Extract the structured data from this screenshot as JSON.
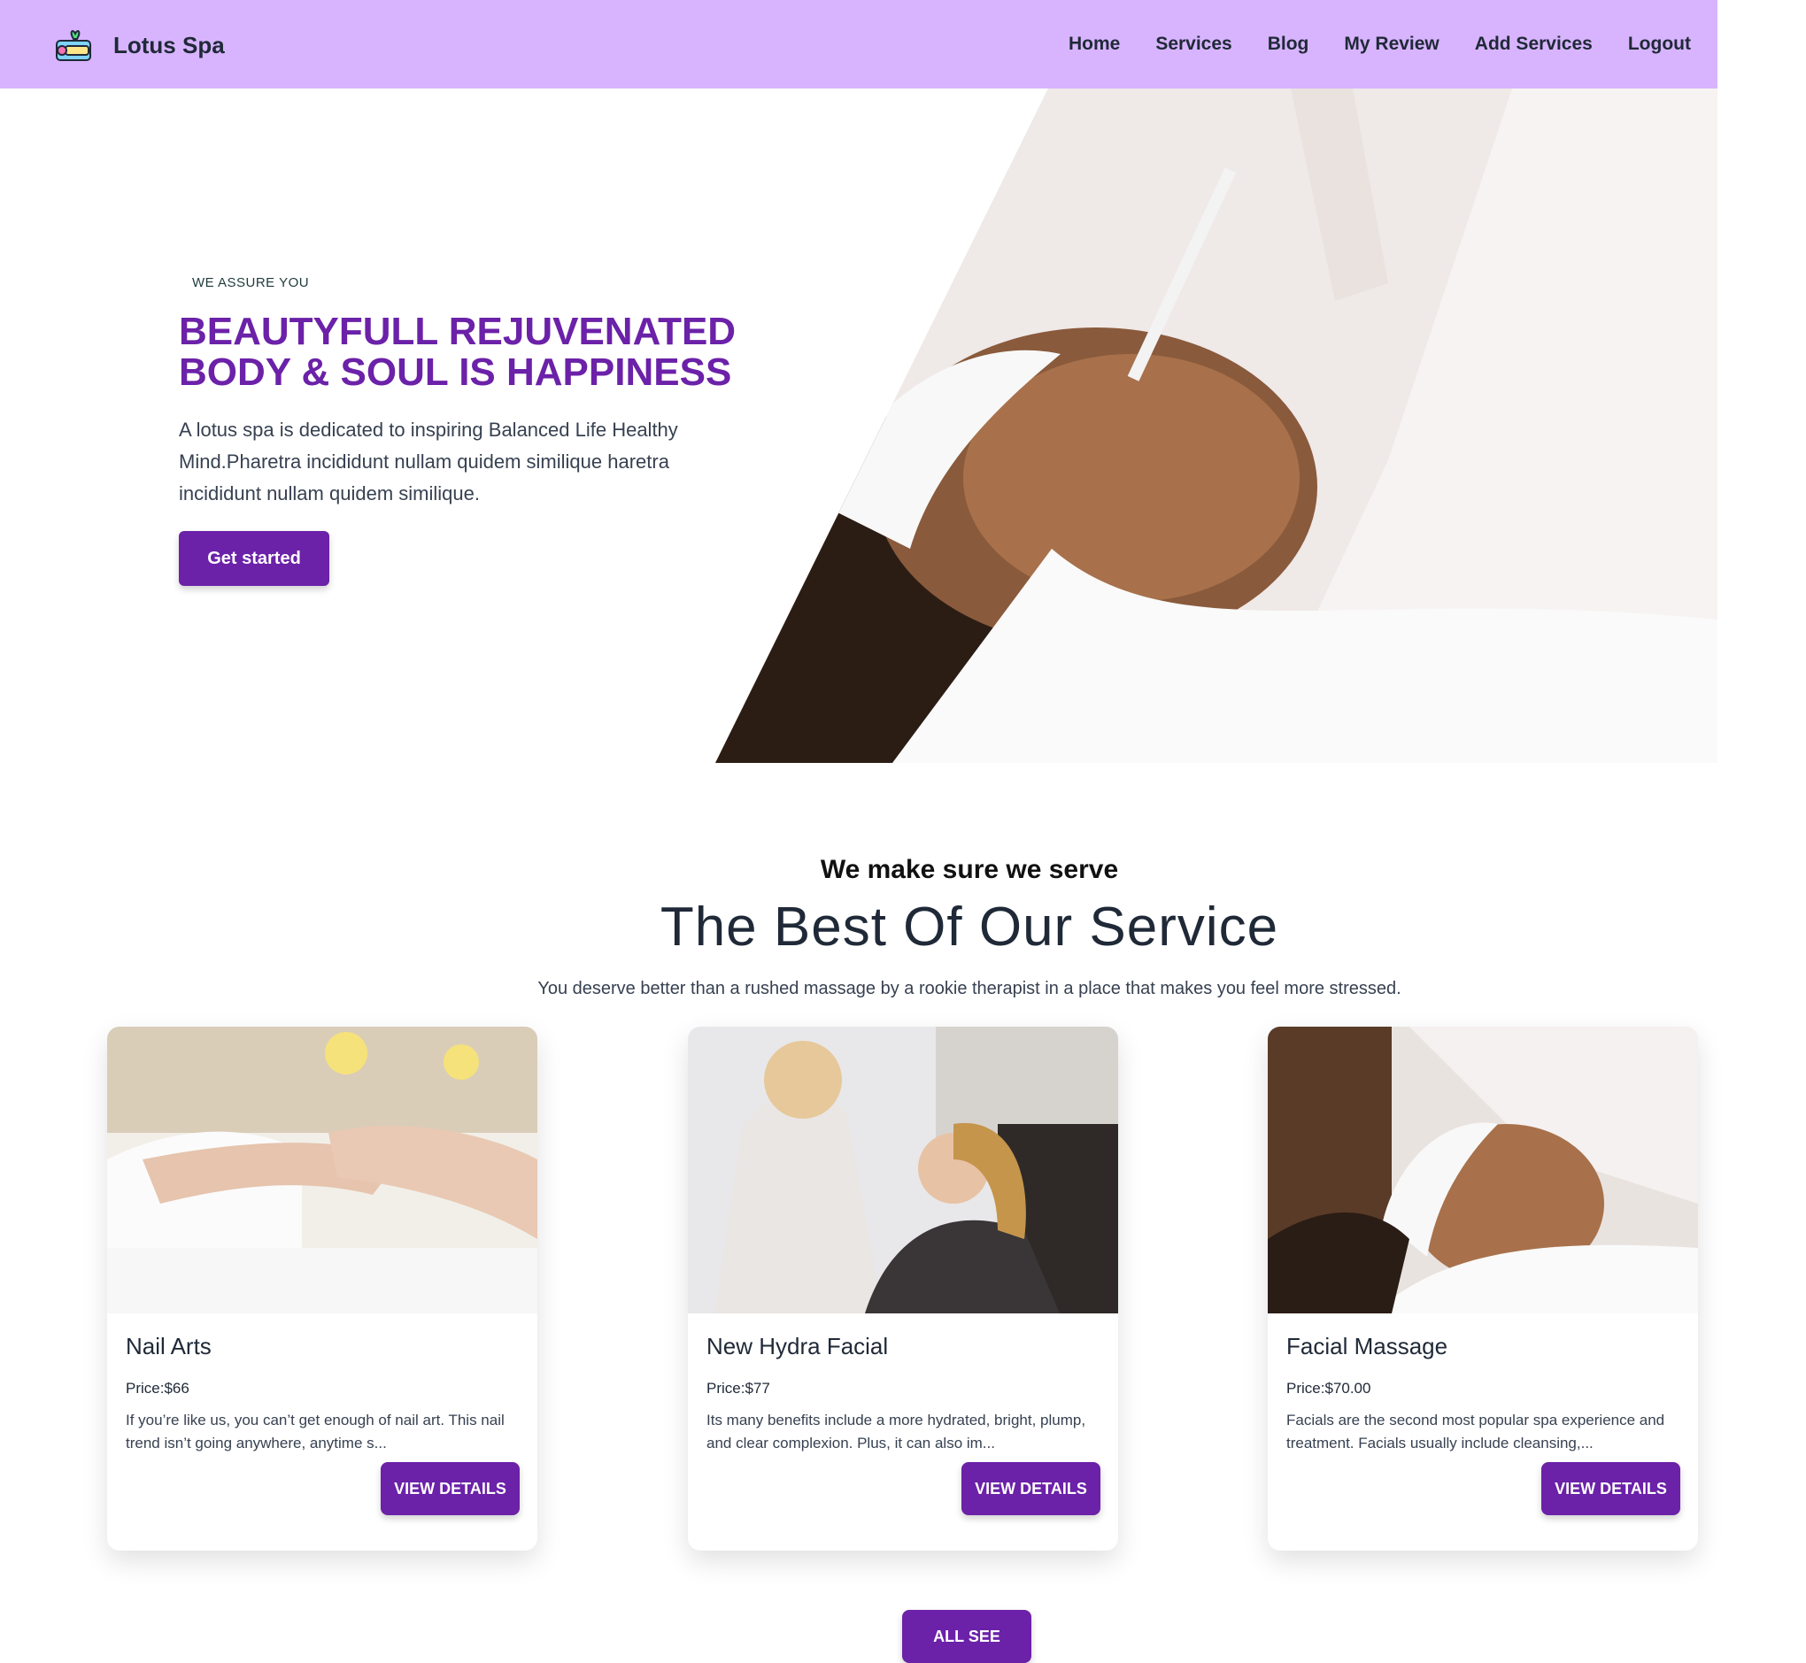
{
  "navbar": {
    "brand": "Lotus Spa",
    "logo_icon": "spa-logo-icon",
    "links": [
      "Home",
      "Services",
      "Blog",
      "My Review",
      "Add Services",
      "Logout"
    ]
  },
  "hero": {
    "eyebrow": "WE ASSURE YOU",
    "title_line1": "BEAUTYFULL REJUVENATED",
    "title_line2": "BODY & SOUL IS HAPPINESS",
    "text": "A lotus spa is dedicated to inspiring Balanced Life Healthy Mind.Pharetra incididunt nullam quidem similique haretra incididunt nullam quidem similique.",
    "button": "Get started"
  },
  "services": {
    "subtitle": "We make sure we serve",
    "title": "The Best Of Our Service",
    "description": "You deserve better than a rushed massage by a rookie therapist in a place that makes you feel more stressed.",
    "cards": [
      {
        "title": "Nail Arts",
        "price": "Price:$66",
        "description": "If you’re like us, you can’t get enough of nail art. This nail trend isn’t going anywhere, anytime s...",
        "button": "VIEW DETAILS"
      },
      {
        "title": "New Hydra Facial",
        "price": "Price:$77",
        "description": "Its many benefits include a more hydrated, bright, plump, and clear complexion. Plus, it can also im...",
        "button": "VIEW DETAILS"
      },
      {
        "title": "Facial Massage",
        "price": "Price:$70.00",
        "description": "Facials are the second most popular spa experience and treatment. Facials usually include cleansing,...",
        "button": "VIEW DETAILS"
      }
    ],
    "all_button": "ALL SEE"
  },
  "colors": {
    "navbar": "#d8b4fe",
    "primary": "#6b21a8"
  }
}
